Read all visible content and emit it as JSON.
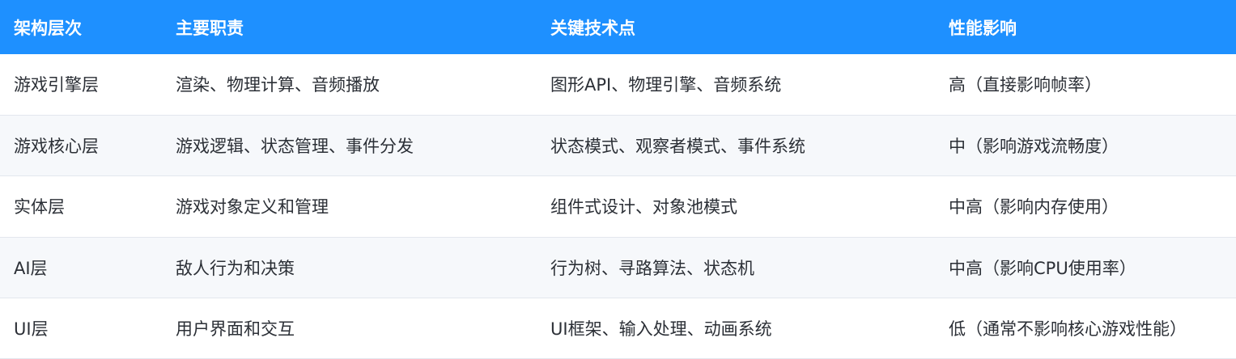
{
  "table": {
    "headers": [
      "架构层次",
      "主要职责",
      "关键技术点",
      "性能影响"
    ],
    "rows": [
      [
        "游戏引擎层",
        "渲染、物理计算、音频播放",
        "图形API、物理引擎、音频系统",
        "高（直接影响帧率）"
      ],
      [
        "游戏核心层",
        "游戏逻辑、状态管理、事件分发",
        "状态模式、观察者模式、事件系统",
        "中（影响游戏流畅度）"
      ],
      [
        "实体层",
        "游戏对象定义和管理",
        "组件式设计、对象池模式",
        "中高（影响内存使用）"
      ],
      [
        "AI层",
        "敌人行为和决策",
        "行为树、寻路算法、状态机",
        "中高（影响CPU使用率）"
      ],
      [
        "UI层",
        "用户界面和交互",
        "UI框架、输入处理、动画系统",
        "低（通常不影响核心游戏性能）"
      ]
    ]
  },
  "colors": {
    "header_bg": "#1e90ff",
    "header_text": "#ffffff",
    "row_alt_bg": "#f6f8fb",
    "body_text": "#2b2f36"
  }
}
